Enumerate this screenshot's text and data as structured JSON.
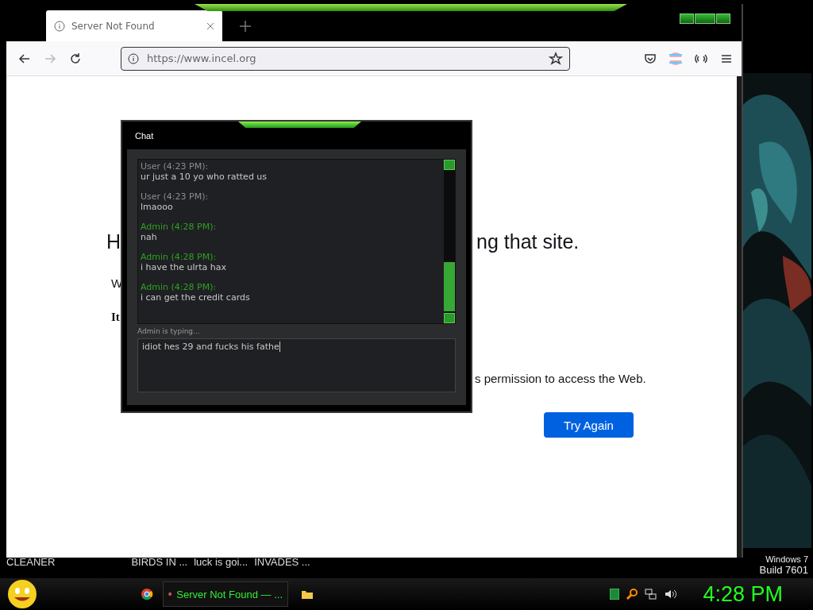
{
  "browser": {
    "tab": {
      "title": "Server Not Found",
      "selected": true
    },
    "address": "https://www.incel.org",
    "page": {
      "heading_left": "H",
      "heading_right": "ng that site.",
      "line_1": "W",
      "line_2": "It",
      "line_3": "s permission to access the Web.",
      "button": "Try Again"
    }
  },
  "chat": {
    "title": "Chat",
    "messages": [
      {
        "kind": "user",
        "author": "User (4:23 PM):",
        "text": "ur just a 10 yo who ratted us"
      },
      {
        "kind": "user",
        "author": "User (4:23 PM):",
        "text": "lmaooo"
      },
      {
        "kind": "admin",
        "author": "Admin (4:28 PM):",
        "text": "nah"
      },
      {
        "kind": "admin",
        "author": "Admin (4:28 PM):",
        "text": "i have the ulrta hax"
      },
      {
        "kind": "admin",
        "author": "Admin (4:28 PM):",
        "text": "i can get the credit cards"
      }
    ],
    "typing": "Admin is typing...",
    "input": "idiot hes 29 and fucks his fathe"
  },
  "desktop": {
    "labels": [
      "CLEANER",
      "BIRDS IN ...",
      "luck is goi...",
      "INVADES ..."
    ],
    "os": "Windows 7",
    "build": "Build 7601"
  },
  "taskbar": {
    "task": "Server Not Found — ...",
    "clock": "4:28 PM"
  }
}
